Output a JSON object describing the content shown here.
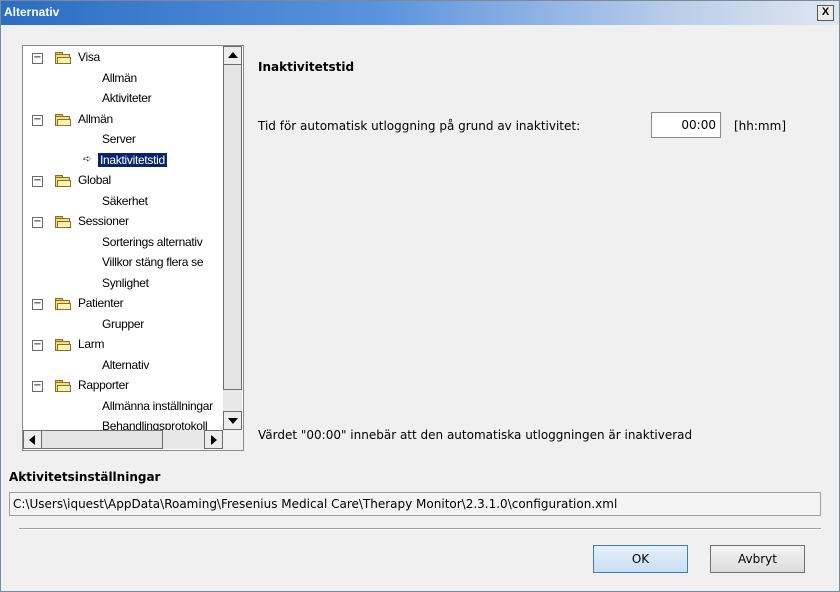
{
  "window": {
    "title": "Alternativ",
    "close_glyph": "X"
  },
  "tree": {
    "items": [
      {
        "label": "Visa",
        "level": 0,
        "expanded": true
      },
      {
        "label": "Allmän",
        "level": 1
      },
      {
        "label": "Aktiviteter",
        "level": 1
      },
      {
        "label": "Allmän",
        "level": 0,
        "expanded": true
      },
      {
        "label": "Server",
        "level": 1
      },
      {
        "label": "Inaktivitetstid",
        "level": 1,
        "selected": true
      },
      {
        "label": "Global",
        "level": 0,
        "expanded": true
      },
      {
        "label": "Säkerhet",
        "level": 1
      },
      {
        "label": "Sessioner",
        "level": 0,
        "expanded": true
      },
      {
        "label": "Sorterings alternativ",
        "level": 1
      },
      {
        "label": "Villkor stäng flera se",
        "level": 1
      },
      {
        "label": "Synlighet",
        "level": 1
      },
      {
        "label": "Patienter",
        "level": 0,
        "expanded": true
      },
      {
        "label": "Grupper",
        "level": 1
      },
      {
        "label": "Larm",
        "level": 0,
        "expanded": true
      },
      {
        "label": "Alternativ",
        "level": 1
      },
      {
        "label": "Rapporter",
        "level": 0,
        "expanded": true
      },
      {
        "label": "Allmänna inställningar",
        "level": 1
      },
      {
        "label": "Behandlingsprotokoll",
        "level": 1
      }
    ],
    "toggle_glyph": "−",
    "selected_glyph": "➪",
    "folder_icon": "folder-open-icon"
  },
  "panel": {
    "title": "Inaktivitetstid",
    "field_label": "Tid för automatisk utloggning på grund av inaktivitet:",
    "field_value": "00:00",
    "field_unit": "[hh:mm]",
    "hint": "Värdet \"00:00\" innebär att den automatiska utloggningen är inaktiverad"
  },
  "settings": {
    "section_title": "Aktivitetsinställningar",
    "path": "C:\\Users\\iquest\\AppData\\Roaming\\Fresenius Medical Care\\Therapy Monitor\\2.3.1.0\\configuration.xml"
  },
  "buttons": {
    "ok": "OK",
    "cancel": "Avbryt"
  },
  "colors": {
    "selection": "#0a246a",
    "titlebar": "#2b6dc3"
  }
}
